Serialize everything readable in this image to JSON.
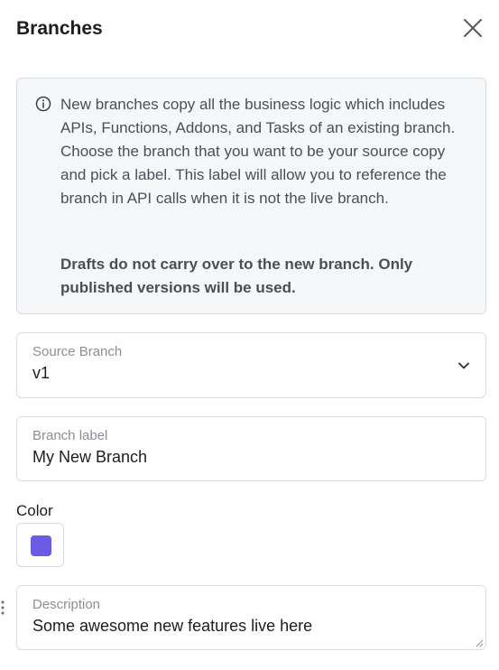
{
  "header": {
    "title": "Branches",
    "close_icon": "close-icon"
  },
  "info": {
    "icon": "info-icon",
    "text": "New branches copy all the business logic which includes APIs, Functions, Addons, and Tasks of an existing branch. Choose the branch that you want to be your source copy and pick a label. This label will allow you to reference the branch in API calls when it is not the live branch.",
    "bold_text": "Drafts do not carry over to the new branch. Only published versions will be used."
  },
  "source_branch": {
    "label": "Source Branch",
    "value": "v1",
    "icon": "chevron-down-icon"
  },
  "branch_label": {
    "label": "Branch label",
    "value": "My New Branch"
  },
  "color": {
    "label": "Color",
    "value": "#6b5ce7"
  },
  "description": {
    "label": "Description",
    "value": "Some awesome new features live here"
  }
}
